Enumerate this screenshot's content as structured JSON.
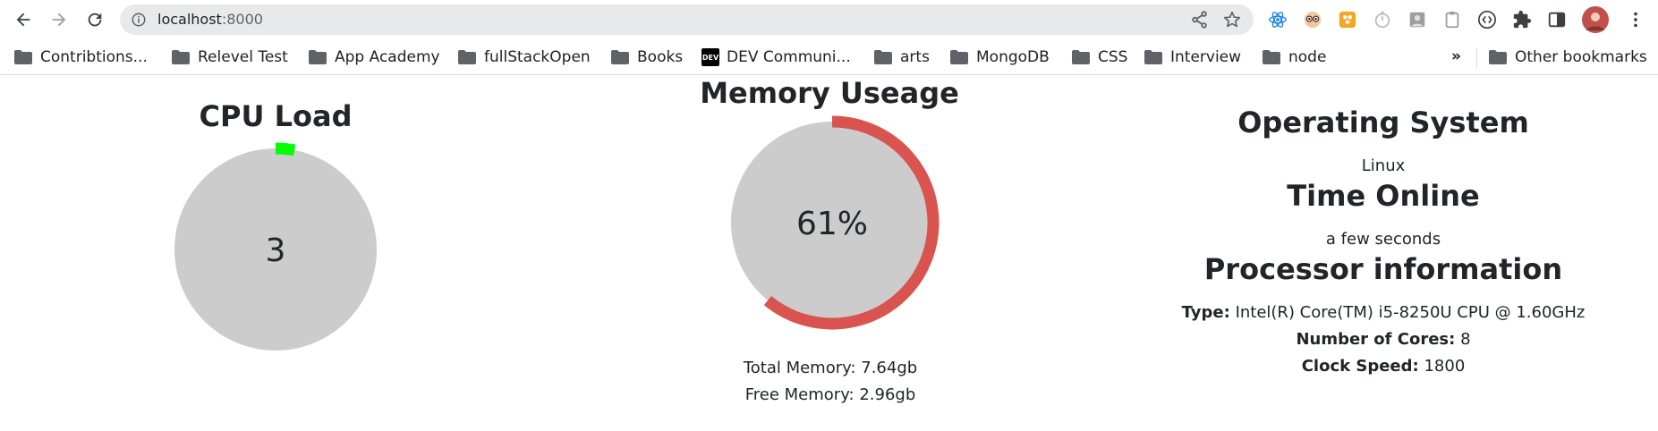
{
  "browser": {
    "url_host": "localhost",
    "url_port": ":8000",
    "bookmarks": [
      {
        "label": "Contribtions...",
        "icon": "folder-icon"
      },
      {
        "label": "Relevel Test",
        "icon": "folder-icon"
      },
      {
        "label": "App Academy",
        "icon": "folder-icon"
      },
      {
        "label": "fullStackOpen",
        "icon": "folder-icon"
      },
      {
        "label": "Books",
        "icon": "folder-icon"
      },
      {
        "label": "DEV Communi...",
        "icon": "dev-icon"
      },
      {
        "label": "arts",
        "icon": "folder-icon"
      },
      {
        "label": "MongoDB",
        "icon": "folder-icon"
      },
      {
        "label": "CSS",
        "icon": "folder-icon"
      },
      {
        "label": "Interview",
        "icon": "folder-icon"
      },
      {
        "label": "node",
        "icon": "folder-icon"
      }
    ],
    "more_bookmarks": "»",
    "other_bookmarks": "Other bookmarks",
    "dev_badge": "DEV"
  },
  "cpu": {
    "title": "CPU Load",
    "value": "3",
    "percent": 3,
    "track_color": "#cccccc",
    "arc_color": "#00ff00"
  },
  "memory": {
    "title": "Memory Useage",
    "value": "61%",
    "percent": 61,
    "track_color": "#cccccc",
    "arc_color": "#d9534f",
    "total_label": "Total Memory: 7.64gb",
    "free_label": "Free Memory: 2.96gb"
  },
  "info": {
    "os_title": "Operating System",
    "os_value": "Linux",
    "uptime_title": "Time Online",
    "uptime_value": "a few seconds",
    "proc_title": "Processor information",
    "type_label": "Type:",
    "type_value": "Intel(R) Core(TM) i5-8250U CPU @ 1.60GHz",
    "cores_label": "Number of Cores:",
    "cores_value": "8",
    "speed_label": "Clock Speed:",
    "speed_value": "1800"
  }
}
